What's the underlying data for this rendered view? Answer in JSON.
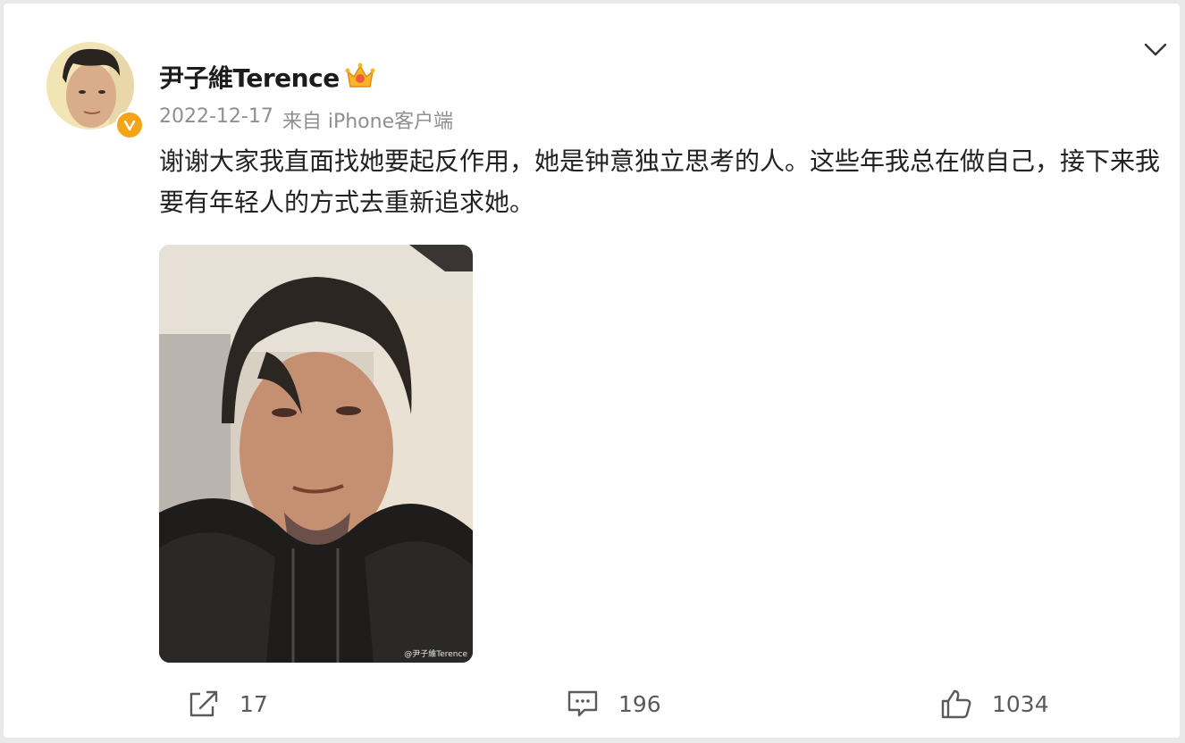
{
  "post": {
    "author_name": "尹子維Terence",
    "timestamp": "2022-12-17",
    "source": "来自 iPhone客户端",
    "text": "谢谢大家我直面找她要起反作用，她是钟意独立思考的人。这些年我总在做自己，接下来我要有年轻人的方式去重新追求她。",
    "image": {
      "watermark": "@尹子維Terence"
    }
  },
  "actions": {
    "repost_count": "17",
    "comment_count": "196",
    "like_count": "1034"
  },
  "icons": {
    "verified": "verified-badge-icon",
    "crown": "crown-icon",
    "menu": "chevron-down-icon",
    "repost": "share-icon",
    "comment": "comment-icon",
    "like": "thumbs-up-icon"
  },
  "colors": {
    "verified_badge": "#f6a417",
    "background": "#e9e9eb",
    "card": "#ffffff",
    "meta_text": "#8f8f8f"
  }
}
